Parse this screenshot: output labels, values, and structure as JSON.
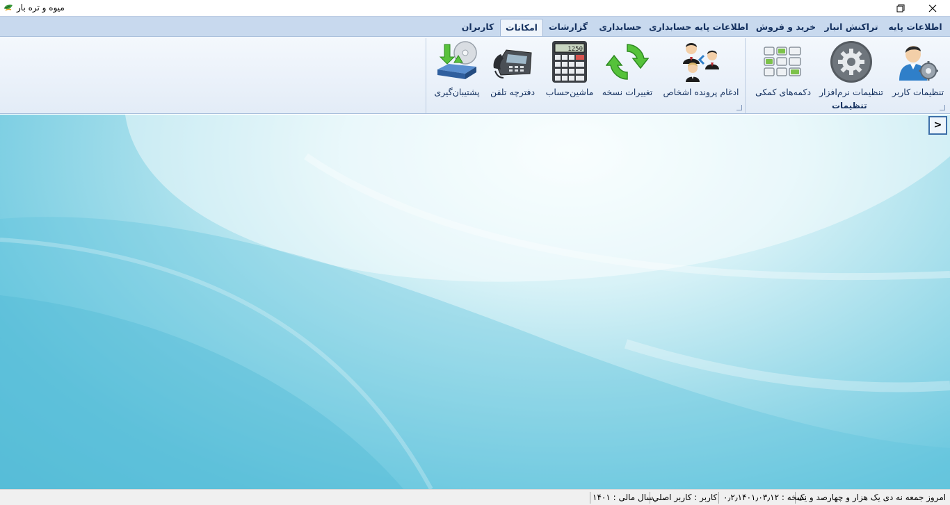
{
  "window": {
    "title": "میوه و تره بار",
    "restore_icon": "restore-icon",
    "close_icon": "close-icon"
  },
  "tabs": [
    {
      "label": "اطلاعات پایه"
    },
    {
      "label": "تراکنش انبار"
    },
    {
      "label": "خرید و فروش"
    },
    {
      "label": "اطلاعات پایه حسابداری"
    },
    {
      "label": "حسابداری"
    },
    {
      "label": "گزارشات"
    },
    {
      "label": "امکانات",
      "active": true
    },
    {
      "label": "کاربران"
    }
  ],
  "ribbon": {
    "groups": [
      {
        "label": "تنظیمات",
        "buttons": [
          {
            "label": "تنظیمات کاربر",
            "icon": "user-settings-icon"
          },
          {
            "label": "تنظیمات نرم‌افزار",
            "icon": "gear-icon"
          },
          {
            "label": "دکمه‌های کمکی",
            "icon": "helper-buttons-icon"
          }
        ]
      },
      {
        "label": "",
        "buttons": [
          {
            "label": "ادغام پرونده اشخاص",
            "icon": "merge-people-icon"
          },
          {
            "label": "تغییرات نسخه",
            "icon": "refresh-icon"
          },
          {
            "label": "ماشین‌حساب",
            "icon": "calculator-icon"
          },
          {
            "label": "دفترچه تلفن",
            "icon": "telephone-icon"
          },
          {
            "label": "پشتیبان‌گیری",
            "icon": "backup-icon"
          }
        ]
      }
    ]
  },
  "panel_toggle": {
    "label": ">"
  },
  "status": {
    "today": "امروز جمعه نه  دی یک هزار و چهارصد و یک",
    "version": "نسخه : ۰٫۲٫۱۴۰۱٫۰۳٫۱۲",
    "user": "کاربر : کاربر اصلي",
    "fiscal_year": "سال مالی : ۱۴۰۱"
  },
  "colors": {
    "tab_strip": "#c8d9ee",
    "ribbon": "#e9f0f9",
    "accent_text": "#15315f",
    "content_bg": "#8fd6e8"
  }
}
